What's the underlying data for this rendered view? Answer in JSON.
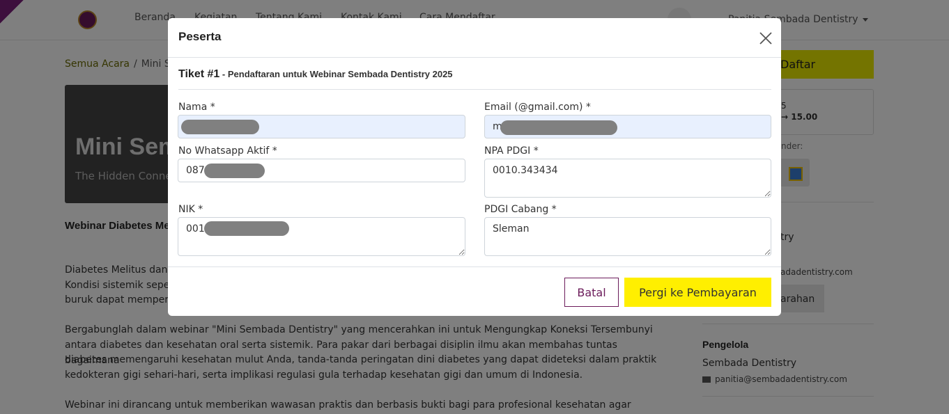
{
  "navbar": {
    "links": [
      "Beranda",
      "Kegiatan",
      "Tentang Kami",
      "Kontak Kami",
      "Cara Mendaftar"
    ],
    "user": "Panitia Sembada Dentistry"
  },
  "breadcrumb": {
    "root": "Semua Acara",
    "current": "Mini Sembada Dentistry"
  },
  "hero": {
    "title": "Mini Sembada Dentistry",
    "subtitle": "The Hidden Connection"
  },
  "event": {
    "subtitle": "Webinar Diabetes Melitus",
    "paragraphs": [
      "Diabetes Melitus dan",
      "Kondisi sistemik sepe",
      "buruk dapat mempers",
      "Bergabunglah dalam webinar \"Mini Sembada Dentistry\" yang mencerahkan ini untuk Mengungkap Koneksi Tersembunyi",
      "antara diabetes dan kesehatan oral serta sistemik. Para pakar dari berbagai disiplin ilmu akan membahas tuntas bagaimana",
      "diabetes memengaruhi kesehatan mulut Anda, tanda-tanda peringatan dini diabetes yang dapat dideteksi dalam praktik",
      "kedokteran gigi sehari-hari, serta implikasi regulasi gula terhadap kesehatan gigi dan umum di Indonesia.",
      "Webinar ini dirancang untuk memberikan wawasan praktis dan berbasis bukti bagi para profesional kesehatan agar dapat"
    ]
  },
  "sidebar": {
    "register_label": "Daftar",
    "date_line1": "5",
    "date_line2": "→ 15.00",
    "reminder_label": "nder:",
    "organizer_partial": "try",
    "email_partial": "adadentistry.com",
    "directions_label": "arahan",
    "organizer_heading": "Pengelola",
    "organizer_name": "Sembada Dentistry",
    "organizer_email": "panitia@sembadadentistry.com"
  },
  "modal": {
    "title": "Peserta",
    "ticket_number": "Tiket #1",
    "ticket_subtitle": " - Pendaftaran untuk Webinar Sembada Dentistry 2025",
    "fields": {
      "nama": {
        "label": "Nama *",
        "value": ""
      },
      "email": {
        "label": "Email (@gmail.com) *",
        "value": "m"
      },
      "whatsapp": {
        "label": "No Whatsapp Aktif *",
        "value": "087"
      },
      "npa": {
        "label": "NPA PDGI *",
        "value": "0010.343434"
      },
      "nik": {
        "label": "NIK *",
        "value": "001"
      },
      "cabang": {
        "label": "PDGI Cabang *",
        "value": "Sleman"
      }
    },
    "cancel_label": "Batal",
    "pay_label": "Pergi ke Pembayaran"
  },
  "colors": {
    "brand_purple": "#6b1b5a",
    "accent_yellow": "#ffef00",
    "autofill_blue": "#e8f0fe",
    "redaction_gray": "#808080"
  }
}
